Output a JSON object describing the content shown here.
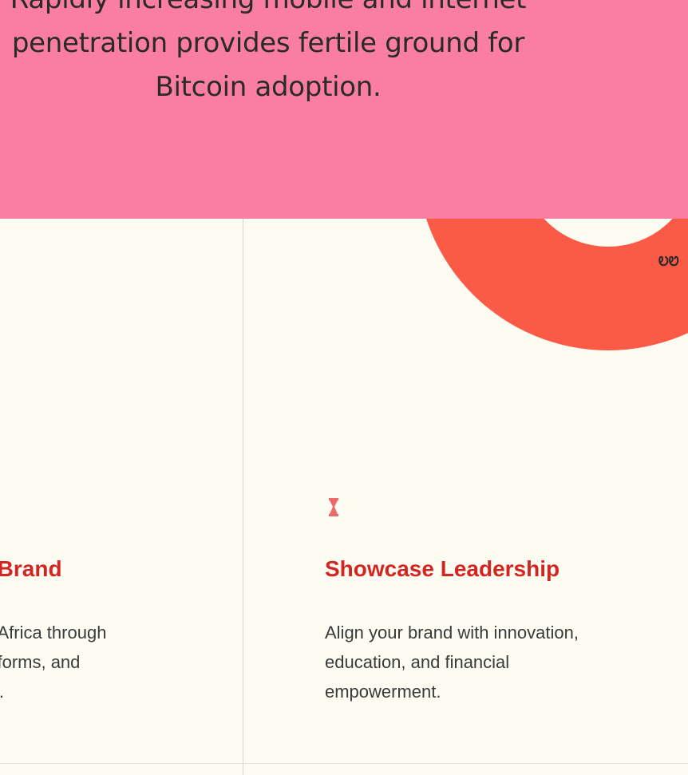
{
  "banner": {
    "text": "Rapidly increasing mobile and internet penetration provides fertile ground for Bitcoin adoption."
  },
  "decor": {
    "glyph": "ᎧᏬ"
  },
  "cards": [
    {
      "title": "r Brand",
      "description": "ross Africa through\nl platforms, and\nrams."
    },
    {
      "title": "Showcase Leadership",
      "description": "Align your brand with innovation,\neducation, and financial\nempowerment.",
      "icon": "trophy-icon"
    }
  ],
  "colors": {
    "banner_bg": "#fa7ea4",
    "page_bg": "#fdfcf2",
    "accent_red": "#d32623",
    "donut": "#fb5b46"
  }
}
